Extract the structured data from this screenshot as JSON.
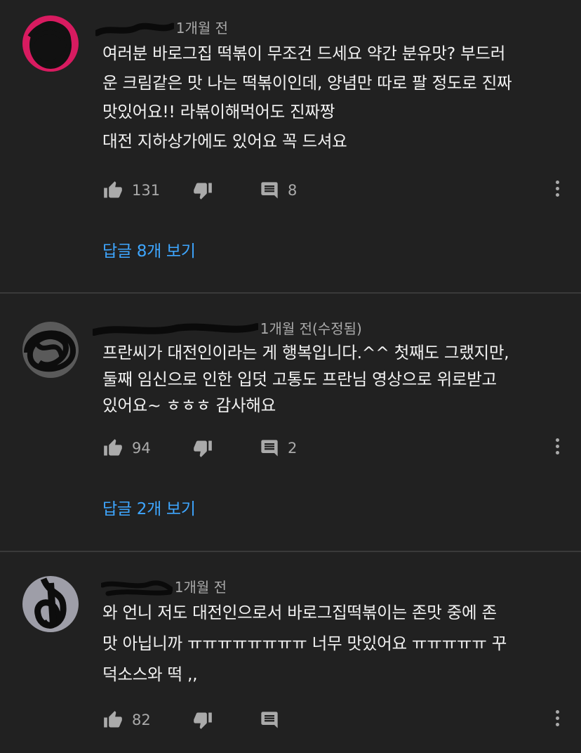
{
  "comments": [
    {
      "author": "",
      "time": "1개월 전",
      "edited": "",
      "text": "여러분 바로그집 떡볶이 무조건 드세요 약간 분유맛? 부드러\n운 크림같은 맛 나는 떡볶이인데, 양념만 따로 팔 정도로 진짜\n맛있어요!! 라볶이해먹어도 진짜짱\n대전 지하상가에도 있어요 꼭 드셔요",
      "likes": "131",
      "reply_count": "8",
      "view_replies": "답글 8개 보기",
      "avatar_color": "#d81b60"
    },
    {
      "author": "",
      "time": "1개월 전(수정됨)",
      "edited": "",
      "text": "프란씨가 대전인이라는 게 행복입니다.^^ 첫째도 그랬지만,\n둘째 임신으로 인한 입덧 고통도 프란님 영상으로 위로받고\n있어요~ ㅎㅎㅎ 감사해요",
      "likes": "94",
      "reply_count": "2",
      "view_replies": "답글 2개 보기",
      "avatar_color": "#6a6a6a"
    },
    {
      "author": "",
      "time": "1개월 전",
      "edited": "",
      "text": "와 언니 저도 대전인으로서 바로그집떡볶이는 존맛 중에 존\n맛 아닙니까 ㅠㅠㅠㅠㅠㅠㅠㅠ 너무 맛있어요 ㅠㅠㅠㅠㅠ 꾸\n덕소스와 떡 ,,",
      "likes": "82",
      "reply_count": "",
      "view_replies": "",
      "avatar_color": "#9e9ea8"
    }
  ],
  "colors": {
    "background": "#212121",
    "text": "#f1f1f1",
    "secondary": "#aaaaaa",
    "link": "#3ea6ff",
    "divider": "#3a3a3a"
  },
  "icons": [
    "thumb-up-icon",
    "thumb-down-icon",
    "comment-reply-icon",
    "more-vert-icon"
  ]
}
